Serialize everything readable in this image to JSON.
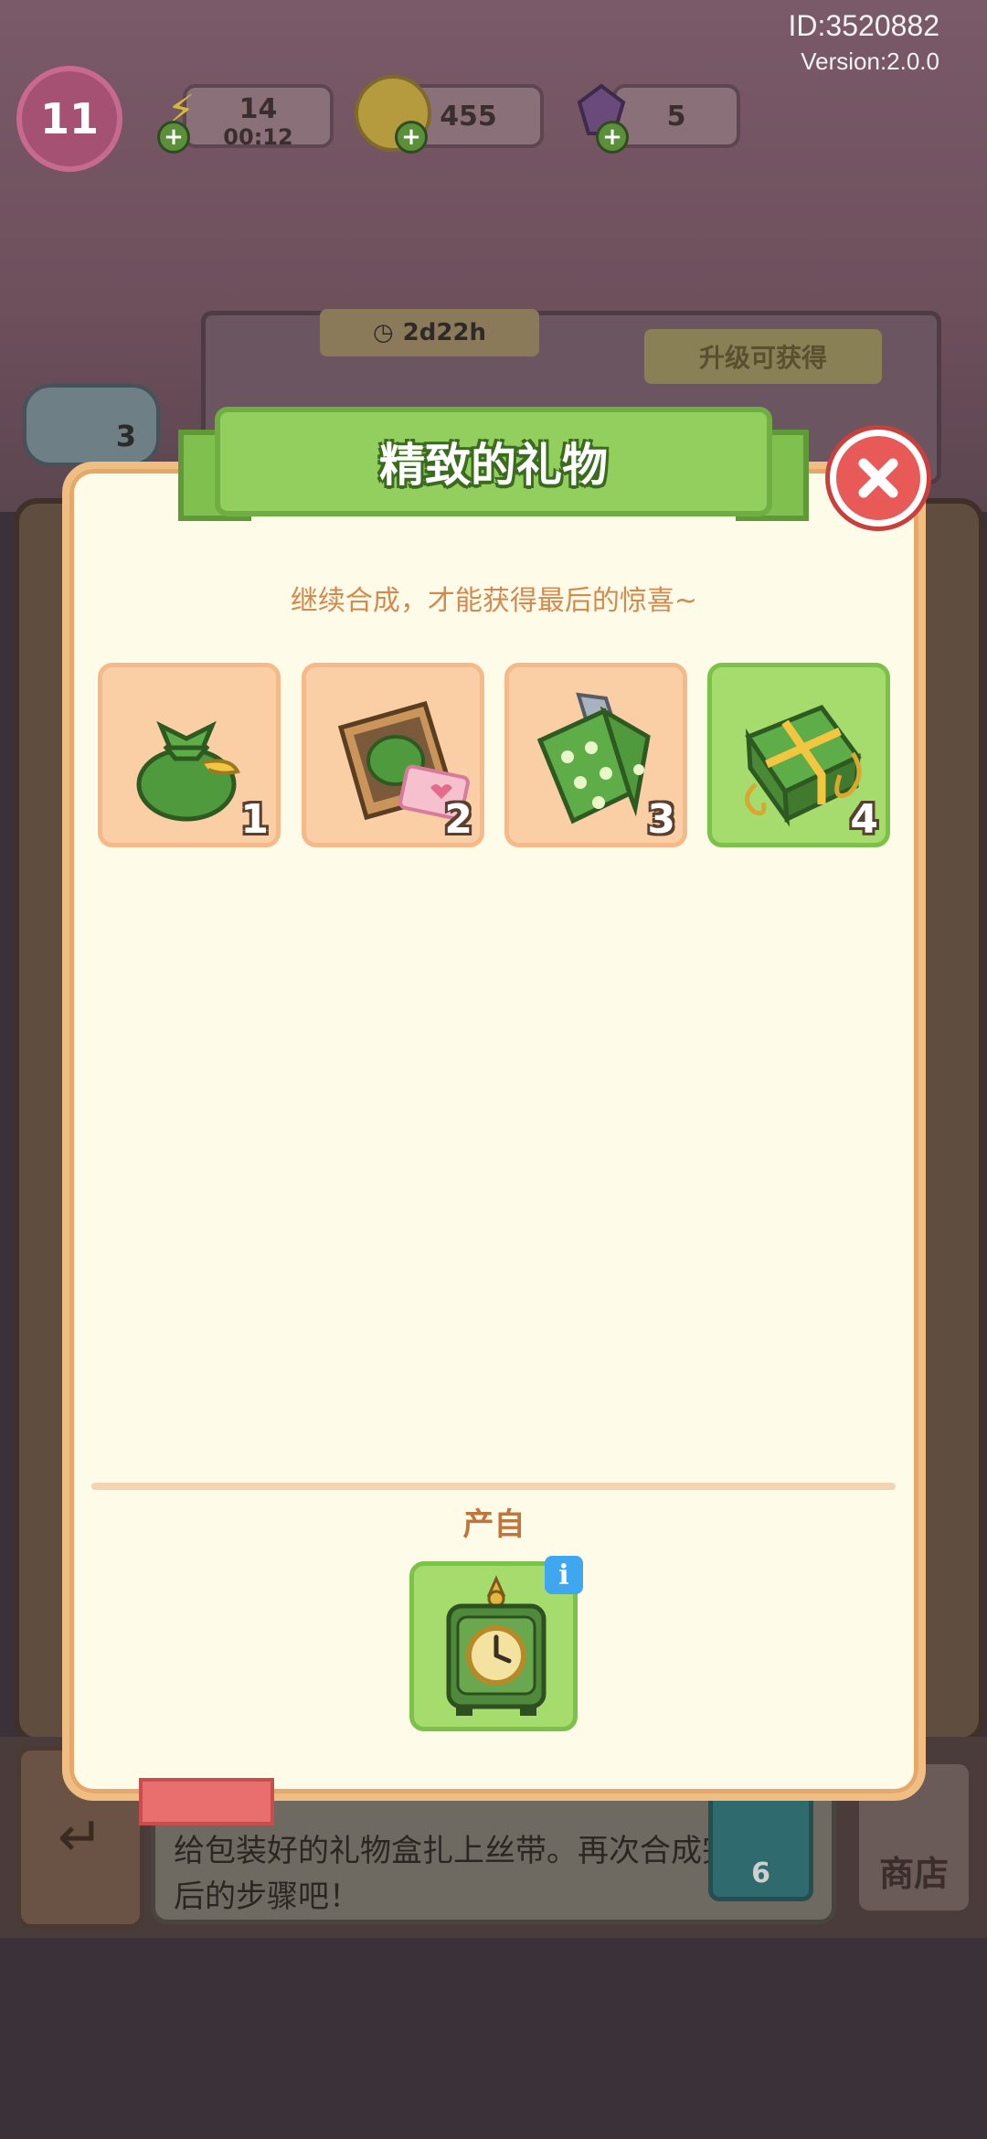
{
  "header": {
    "id_text": "ID:3520882",
    "version_text": "Version:2.0.0",
    "level": "11",
    "energy": {
      "value": "14",
      "timer": "00:12"
    },
    "coins": "455",
    "gems": "5"
  },
  "event": {
    "timer": "2d22h",
    "upgrade_label": "升级可获得",
    "character_count": "3"
  },
  "modal": {
    "title": "精致的礼物",
    "subtitle": "继续合成，才能获得最后的惊喜~",
    "chain": [
      {
        "level": "1",
        "icon": "green-pouch-icon",
        "active": false
      },
      {
        "level": "2",
        "icon": "open-gift-box-icon",
        "active": false
      },
      {
        "level": "3",
        "icon": "wrapping-paper-icon",
        "active": false
      },
      {
        "level": "4",
        "icon": "wrapped-gift-icon",
        "active": true
      }
    ],
    "source_label": "产自",
    "source_icon": "green-clock-icon",
    "info_icon": "i"
  },
  "bottom": {
    "tip_text": "给包装好的礼物盒扎上丝带。再次合成完成最后的步骤吧！",
    "slot_count": "6",
    "shop_label": "商店"
  },
  "colors": {
    "panel_bg": "#fefbe9",
    "panel_border": "#f0be83",
    "banner_green": "#92cf5f",
    "tile_peach": "#fbcfa6",
    "tile_green": "#a6dc6e",
    "close_red": "#e85a57",
    "subtitle_orange": "#d28a4f"
  }
}
